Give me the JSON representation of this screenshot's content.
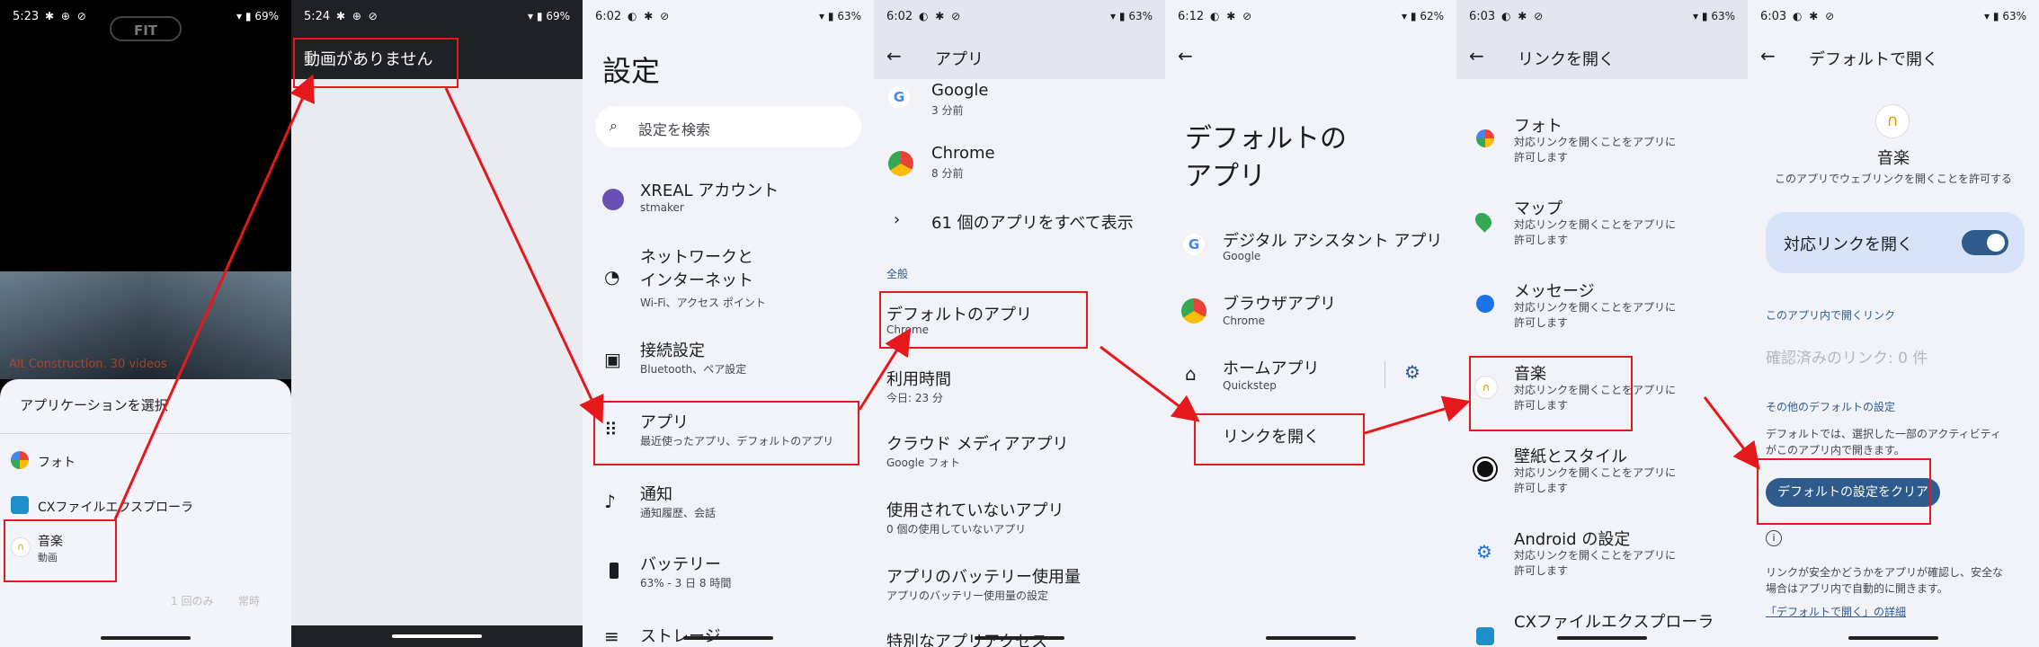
{
  "panel1": {
    "status": {
      "time": "5:23",
      "battery": "69%"
    },
    "fit_label": "FIT",
    "watermark": "Alt Construction. 30 videos",
    "sheet": {
      "title": "アプリケーションを選択",
      "apps": [
        {
          "name": "フォト",
          "sub": ""
        },
        {
          "name": "CXファイルエクスプローラ",
          "sub": ""
        },
        {
          "name": "音楽",
          "sub": "動画"
        }
      ],
      "btn_once": "1 回のみ",
      "btn_always": "常時"
    }
  },
  "panel2": {
    "status": {
      "time": "5:24",
      "battery": "69%"
    },
    "no_video": "動画がありません"
  },
  "panel3": {
    "status": {
      "time": "6:02",
      "battery": "63%"
    },
    "title": "設定",
    "search_placeholder": "設定を検索",
    "items": [
      {
        "title": "XREAL アカウント",
        "sub": "stmaker"
      },
      {
        "title": "ネットワークと\nインターネット",
        "sub": "Wi-Fi、アクセス ポイント"
      },
      {
        "title": "接続設定",
        "sub": "Bluetooth、ペア設定"
      },
      {
        "title": "アプリ",
        "sub": "最近使ったアプリ、デフォルトのアプリ"
      },
      {
        "title": "通知",
        "sub": "通知履歴、会話"
      },
      {
        "title": "バッテリー",
        "sub": "63% - 3 日 8 時間"
      },
      {
        "title": "ストレージ",
        "sub": ""
      }
    ]
  },
  "panel4": {
    "status": {
      "time": "6:02",
      "battery": "63%"
    },
    "title": "アプリ",
    "recent": [
      {
        "title": "Google",
        "sub": "3 分前"
      },
      {
        "title": "Chrome",
        "sub": "8 分前"
      }
    ],
    "show_all": "61 個のアプリをすべて表示",
    "section": "全般",
    "items": [
      {
        "title": "デフォルトのアプリ",
        "sub": "Chrome"
      },
      {
        "title": "利用時間",
        "sub": "今日: 23 分"
      },
      {
        "title": "クラウド メディアアプリ",
        "sub": "Google フォト"
      },
      {
        "title": "使用されていないアプリ",
        "sub": "0 個の使用していないアプリ"
      },
      {
        "title": "アプリのバッテリー使用量",
        "sub": "アプリのバッテリー使用量の設定"
      },
      {
        "title": "特別なアプリアクセス",
        "sub": ""
      }
    ]
  },
  "panel5": {
    "status": {
      "time": "6:12",
      "battery": "62%"
    },
    "title": "デフォルトの\nアプリ",
    "items": [
      {
        "title": "デジタル アシスタント アプリ",
        "sub": "Google"
      },
      {
        "title": "ブラウザアプリ",
        "sub": "Chrome"
      },
      {
        "title": "ホームアプリ",
        "sub": "Quickstep"
      }
    ],
    "open_links": "リンクを開く"
  },
  "panel6": {
    "status": {
      "time": "6:03",
      "battery": "63%"
    },
    "title": "リンクを開く",
    "items": [
      {
        "title": "フォト",
        "sub": "対応リンクを開くことをアプリに\n許可します"
      },
      {
        "title": "マップ",
        "sub": "対応リンクを開くことをアプリに\n許可します"
      },
      {
        "title": "メッセージ",
        "sub": "対応リンクを開くことをアプリに\n許可します"
      },
      {
        "title": "音楽",
        "sub": "対応リンクを開くことをアプリに\n許可します"
      },
      {
        "title": "壁紙とスタイル",
        "sub": "対応リンクを開くことをアプリに\n許可します"
      },
      {
        "title": "Android の設定",
        "sub": "対応リンクを開くことをアプリに\n許可します"
      },
      {
        "title": "CXファイルエクスプローラ",
        "sub": ""
      }
    ]
  },
  "panel7": {
    "status": {
      "time": "6:03",
      "battery": "63%"
    },
    "title": "デフォルトで開く",
    "app_name": "音楽",
    "app_desc": "このアプリでウェブリンクを開くことを許可する",
    "toggle_label": "対応リンクを開く",
    "toggle_on": true,
    "section_links": "このアプリ内で開くリンク",
    "verified": "確認済みのリンク: 0 件",
    "section_other": "その他のデフォルトの設定",
    "other_desc": "デフォルトでは、選択した一部のアクティビティ\nがこのアプリ内で開きます。",
    "clear_button": "デフォルトの設定をクリア",
    "info_text": "リンクが安全かどうかをアプリが確認し、安全な\n場合はアプリ内で自動的に開きます。",
    "learn_more": "「デフォルトで開く」の詳細"
  },
  "colors": {
    "accent": "#2e5b8c",
    "annotation": "#e5191c",
    "toggle_bg": "#d7e3f8",
    "panel_bg": "#f1f3f8"
  }
}
